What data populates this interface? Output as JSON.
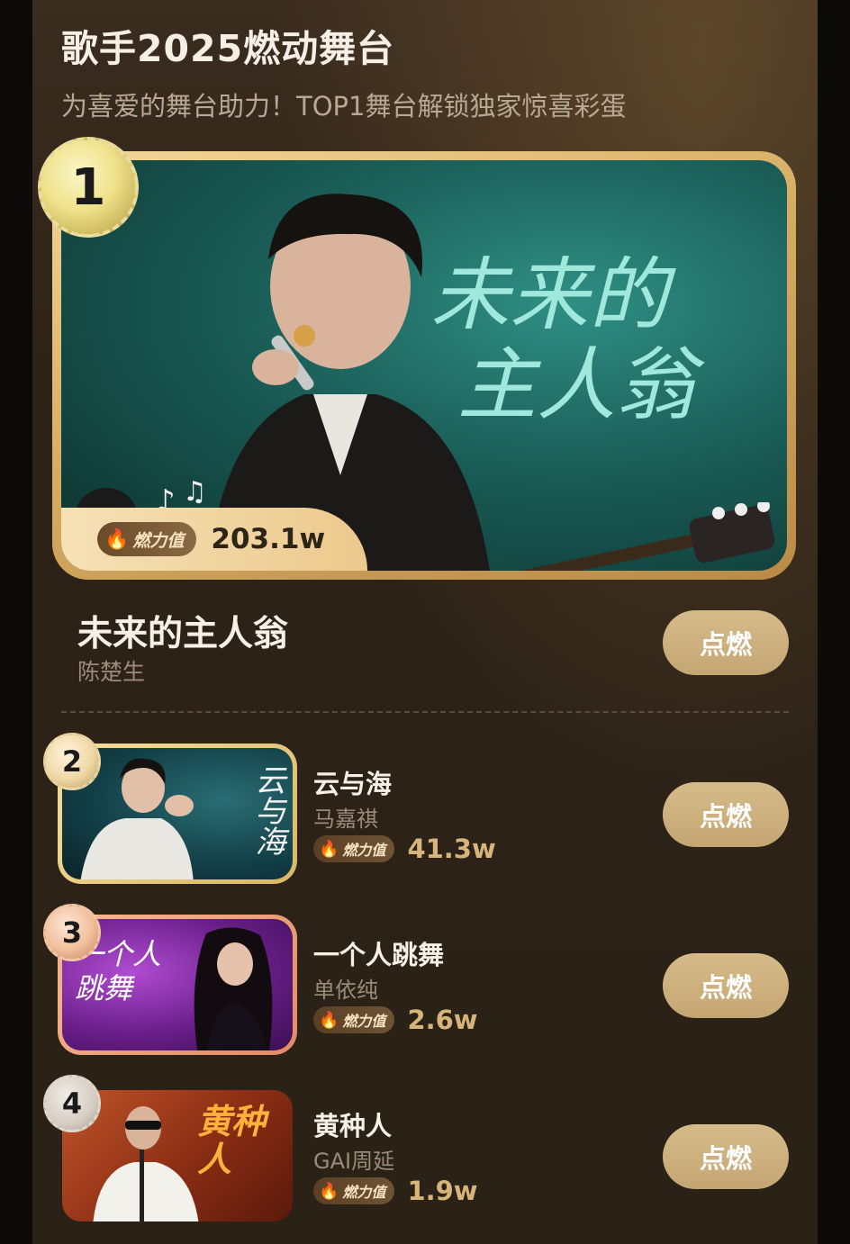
{
  "header": {
    "title": "歌手2025燃动舞台",
    "subtitle": "为喜爱的舞台助力！TOP1舞台解锁独家惊喜彩蛋"
  },
  "heat_label": "燃力值",
  "ignite_label": "点燃",
  "hero": {
    "rank": "1",
    "heat": "203.1w",
    "title": "未来的主人翁",
    "artist": "陈楚生",
    "art_text": "未来的主人翁"
  },
  "rows": [
    {
      "rank": "2",
      "title": "云与海",
      "artist": "马嘉祺",
      "heat": "41.3w",
      "art_text": "云与海"
    },
    {
      "rank": "3",
      "title": "一个人跳舞",
      "artist": "单依纯",
      "heat": "2.6w",
      "art_text": "一个人跳舞"
    },
    {
      "rank": "4",
      "title": "黄种人",
      "artist": "GAI周延",
      "heat": "1.9w",
      "art_text": "黄种人"
    }
  ],
  "colors": {
    "panel_bg": "#2e2318",
    "gold": "#d7b57a",
    "ignite_button": "#c9ad7c"
  }
}
